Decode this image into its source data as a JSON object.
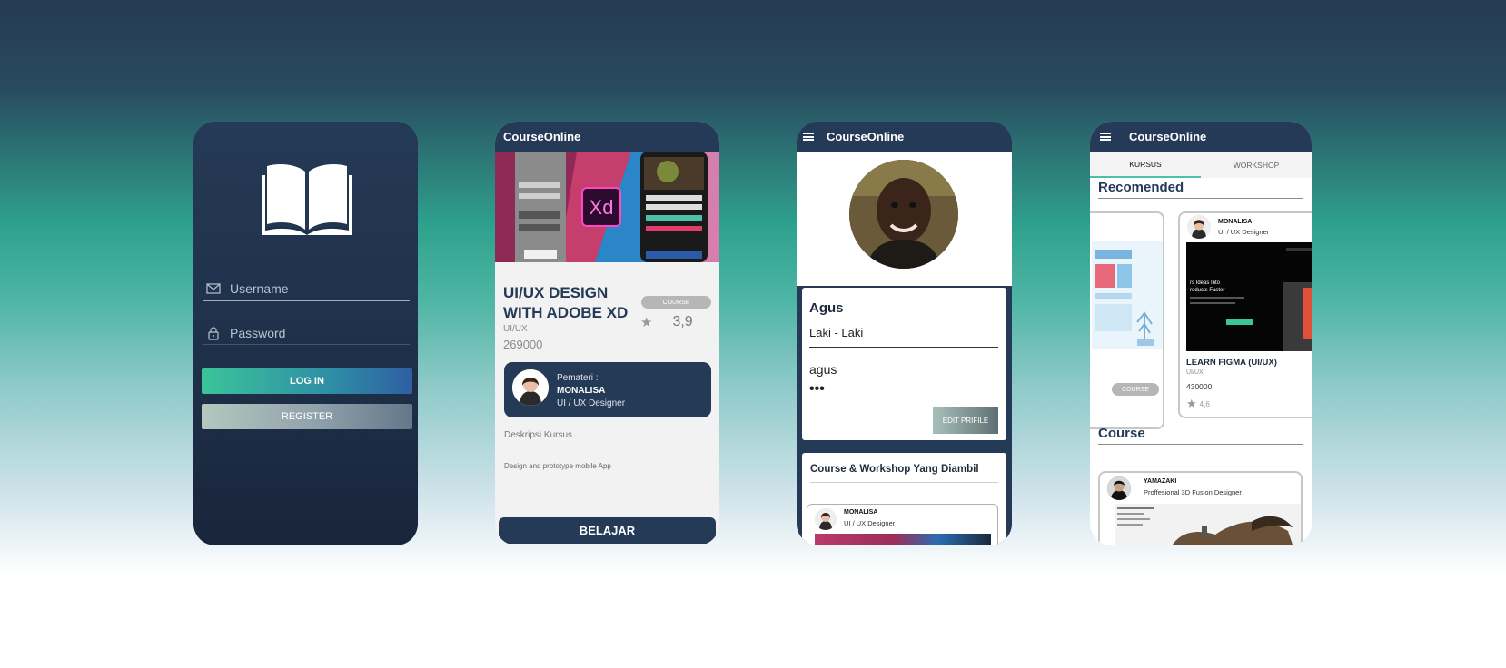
{
  "login": {
    "username_placeholder": "Username",
    "password_placeholder": "Password",
    "login_label": "LOG IN",
    "register_label": "REGISTER"
  },
  "detail": {
    "app_title": "CourseOnline",
    "banner_icon_text": "Xd",
    "course_title": "UI/UX DESIGN WITH ADOBE XD",
    "category": "UI/UX",
    "price": "269000",
    "type_badge": "COURSE",
    "rating": "3,9",
    "mentor_caption": "Pemateri :",
    "mentor_name": "MONALISA",
    "mentor_role": "UI / UX Designer",
    "description_heading": "Deskripsi Kursus",
    "description_body": "Design and prototype mobile App",
    "cta_label": "BELAJAR"
  },
  "profile": {
    "app_title": "CourseOnline",
    "name": "Agus",
    "gender": "Laki - Laki",
    "username": "agus",
    "password_mask": "•••",
    "edit_label": "EDIT PRIFILE",
    "taken_heading": "Course & Workshop Yang Diambil",
    "taken_item_mentor": "MONALISA",
    "taken_item_role": "UI / UX Designer"
  },
  "home": {
    "app_title": "CourseOnline",
    "tabs": [
      {
        "label": "KURSUS",
        "active": true
      },
      {
        "label": "WORKSHOP",
        "active": false
      }
    ],
    "recommended_heading": "Recomended",
    "left_card_badge": "COURSE",
    "rec_mentor": "MONALISA",
    "rec_role": "UI / UX Designer",
    "rec_title": "LEARN FIGMA (UI/UX)",
    "rec_category": "UI/UX",
    "rec_price": "430000",
    "rec_rating": "4,6",
    "rec_image_text_1": "rs Ideas Into",
    "rec_image_text_2": "roducts Faster",
    "course_heading": "Course",
    "course_mentor": "YAMAZAKI",
    "course_role": "Proffesional 3D Fusion Designer"
  },
  "colors": {
    "navy": "#253a57",
    "teal": "#3cc49b",
    "blue": "#2f5fa4"
  }
}
